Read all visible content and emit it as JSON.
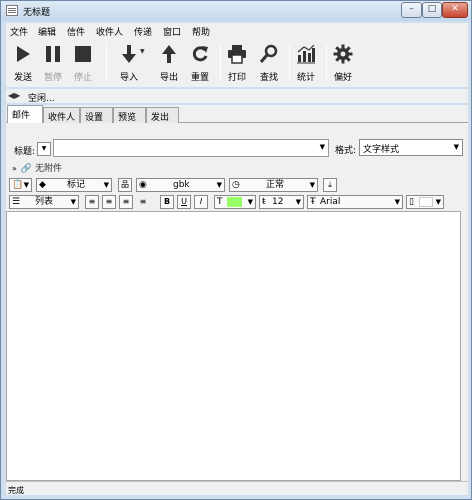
{
  "window": {
    "title": "无标题"
  },
  "window_controls": {
    "minimize": "–",
    "maximize": "□",
    "close": "✕"
  },
  "menu": [
    "文件",
    "编辑",
    "信件",
    "收件人",
    "传递",
    "窗口",
    "帮助"
  ],
  "toolbar": [
    {
      "label": "发送",
      "icon": "play-icon",
      "enabled": true
    },
    {
      "label": "暂停",
      "icon": "pause-icon",
      "enabled": false
    },
    {
      "label": "停止",
      "icon": "stop-icon",
      "enabled": false
    },
    {
      "label": "导入",
      "icon": "download-arrow-icon",
      "enabled": true
    },
    {
      "label": "导出",
      "icon": "upload-arrow-icon",
      "enabled": true
    },
    {
      "label": "重置",
      "icon": "refresh-icon",
      "enabled": true
    },
    {
      "label": "打印",
      "icon": "printer-icon",
      "enabled": true
    },
    {
      "label": "查找",
      "icon": "magnifier-icon",
      "enabled": true
    },
    {
      "label": "统计",
      "icon": "bar-chart-icon",
      "enabled": true
    },
    {
      "label": "偏好",
      "icon": "gear-icon",
      "enabled": true
    }
  ],
  "status_row": {
    "text": "空闲..."
  },
  "tabs": [
    "邮件",
    "收件人",
    "设置",
    "预览",
    "发出"
  ],
  "active_tab": "邮件",
  "form": {
    "subject_label": "标题:",
    "subject_value": "",
    "format_label": "格式:",
    "format_value": "文字样式",
    "attachments_text": "无附件"
  },
  "format_row1": {
    "mark_label": "标记",
    "charset_value": "gbk",
    "priority_value": "正常"
  },
  "format_row2": {
    "list_label": "列表",
    "bold": "B",
    "underline": "U",
    "italic": "I",
    "text_color_label": "T",
    "highlight_color": "#99ff66",
    "font_size_value": "12",
    "font_name_value": "Arial"
  },
  "statusbar": {
    "text": "完成"
  }
}
